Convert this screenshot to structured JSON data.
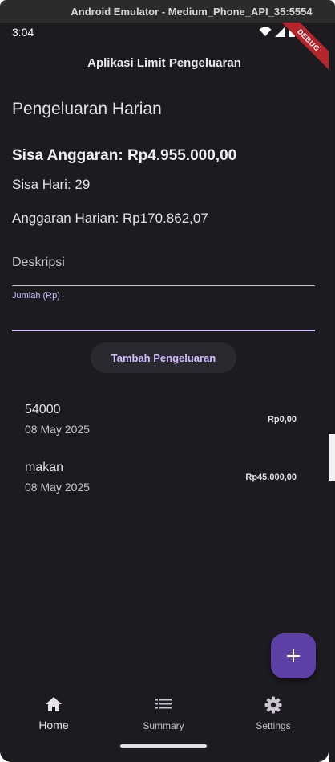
{
  "window": {
    "title": "Android Emulator - Medium_Phone_API_35:5554"
  },
  "statusbar": {
    "time": "3:04",
    "debug_label": "DEBUG"
  },
  "appbar": {
    "title": "Aplikasi Limit Pengeluaran"
  },
  "main": {
    "heading": "Pengeluaran Harian",
    "sisa_anggaran": "Sisa Anggaran: Rp4.955.000,00",
    "sisa_hari": "Sisa Hari: 29",
    "anggaran_harian": "Anggaran Harian: Rp170.862,07",
    "desc_placeholder": "Deskripsi",
    "jumlah_label": "Jumlah (Rp)",
    "add_button": "Tambah Pengeluaran"
  },
  "expenses": [
    {
      "title": "54000",
      "date": "08 May 2025",
      "amount": "Rp0,00"
    },
    {
      "title": "makan",
      "date": "08 May 2025",
      "amount": "Rp45.000,00"
    }
  ],
  "fab": {
    "icon": "plus-icon"
  },
  "nav": [
    {
      "label": "Home",
      "icon": "home-icon",
      "active": true
    },
    {
      "label": "Summary",
      "icon": "list-icon",
      "active": false
    },
    {
      "label": "Settings",
      "icon": "gear-icon",
      "active": false
    }
  ],
  "colors": {
    "accent": "#D0BCFF",
    "fab": "#5D3FA6",
    "background": "#1C1B20",
    "debug": "#B3262B"
  }
}
